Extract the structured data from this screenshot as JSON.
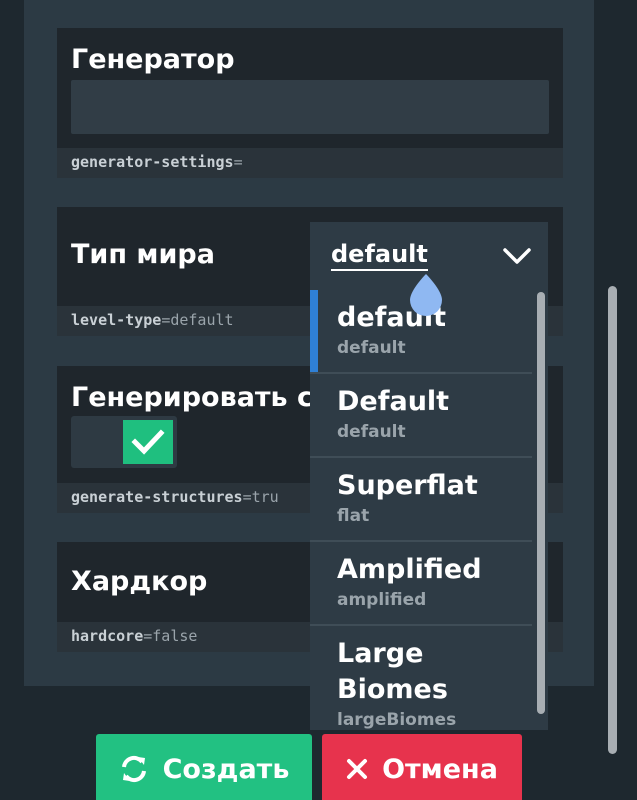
{
  "generator": {
    "title": "Генератор",
    "input_value": "",
    "prop_key": "generator-settings",
    "prop_eq": "=",
    "prop_value": ""
  },
  "level_type": {
    "title": "Тип мира",
    "selected": "default",
    "prop_key": "level-type",
    "prop_eq": "=",
    "prop_value": "default"
  },
  "structures": {
    "title": "Генерировать с",
    "checked": true,
    "prop_key": "generate-structures",
    "prop_eq": "=",
    "prop_value": "tru"
  },
  "hardcore": {
    "title": "Хардкор",
    "prop_key": "hardcore",
    "prop_eq": "=",
    "prop_value": "false"
  },
  "dropdown": {
    "options": [
      {
        "label": "default",
        "value": "default",
        "active": true
      },
      {
        "label": "Default",
        "value": "default"
      },
      {
        "label": "Superflat",
        "value": "flat"
      },
      {
        "label": "Amplified",
        "value": "amplified"
      },
      {
        "label": "Large Biomes",
        "value": "largeBiomes"
      }
    ]
  },
  "buttons": {
    "create_label": "Создать",
    "cancel_label": "Отмена"
  },
  "colors": {
    "create": "#22c182",
    "cancel": "#e7334d",
    "toggle_on": "#1fbf7f",
    "active_marker": "#2f80d6"
  },
  "icons": {
    "create": "refresh-icon",
    "cancel": "close-icon",
    "select": "chevron-down-icon",
    "toggle": "checkmark-icon"
  }
}
